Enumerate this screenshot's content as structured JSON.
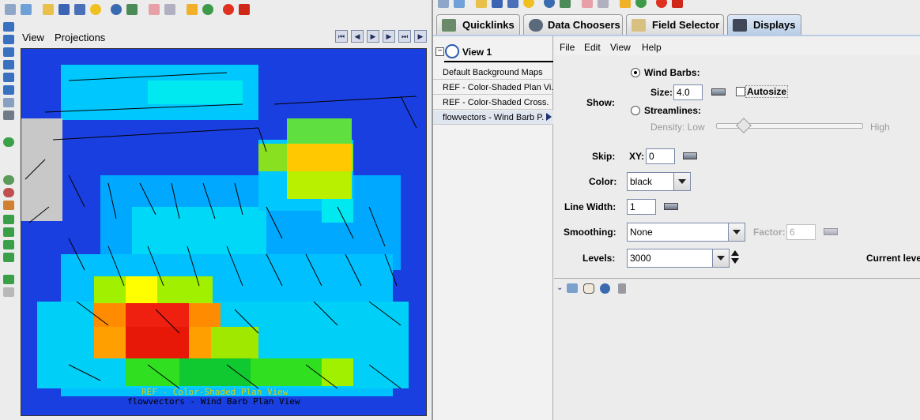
{
  "left_panel": {
    "menu": {
      "view": "View",
      "projections": "Projections"
    },
    "map_legend": {
      "line1": "REF - Color-Shaded Plan View",
      "line2": "flowvectors - Wind Barb Plan View"
    }
  },
  "tabs": [
    {
      "label": "Quicklinks",
      "icon": "quicklinks-icon"
    },
    {
      "label": "Data Choosers",
      "icon": "data-choosers-icon"
    },
    {
      "label": "Field Selector",
      "icon": "field-selector-icon"
    },
    {
      "label": "Displays",
      "icon": "displays-icon"
    }
  ],
  "view_tree": {
    "title": "View 1",
    "collapse_symbol": "−",
    "layers": [
      "Default Background Maps",
      "REF - Color-Shaded Plan Vi.",
      "REF - Color-Shaded Cross.",
      "flowvectors - Wind Barb P."
    ]
  },
  "display_menu": {
    "file": "File",
    "edit": "Edit",
    "view": "View",
    "help": "Help"
  },
  "controls": {
    "show_label": "Show:",
    "wind_barbs": "Wind Barbs:",
    "size_label": "Size:",
    "size_value": "4.0",
    "autosize": "Autosize",
    "streamlines": "Streamlines:",
    "density_label": "Density: Low",
    "density_high": "High",
    "skip_label": "Skip:",
    "xy_label": "XY:",
    "skip_value": "0",
    "color_label": "Color:",
    "color_value": "black",
    "line_width_label": "Line Width:",
    "line_width_value": "1",
    "smoothing_label": "Smoothing:",
    "smoothing_value": "None",
    "factor_label": "Factor:",
    "factor_value": "6",
    "levels_label": "Levels:",
    "levels_value": "3000",
    "current_level_label": "Current leve"
  },
  "colors": {
    "legend_text": "#e0d000",
    "tab_selected": "#c9d8ec",
    "map_low": "#1a3fe0",
    "map_high": "#e82010"
  }
}
